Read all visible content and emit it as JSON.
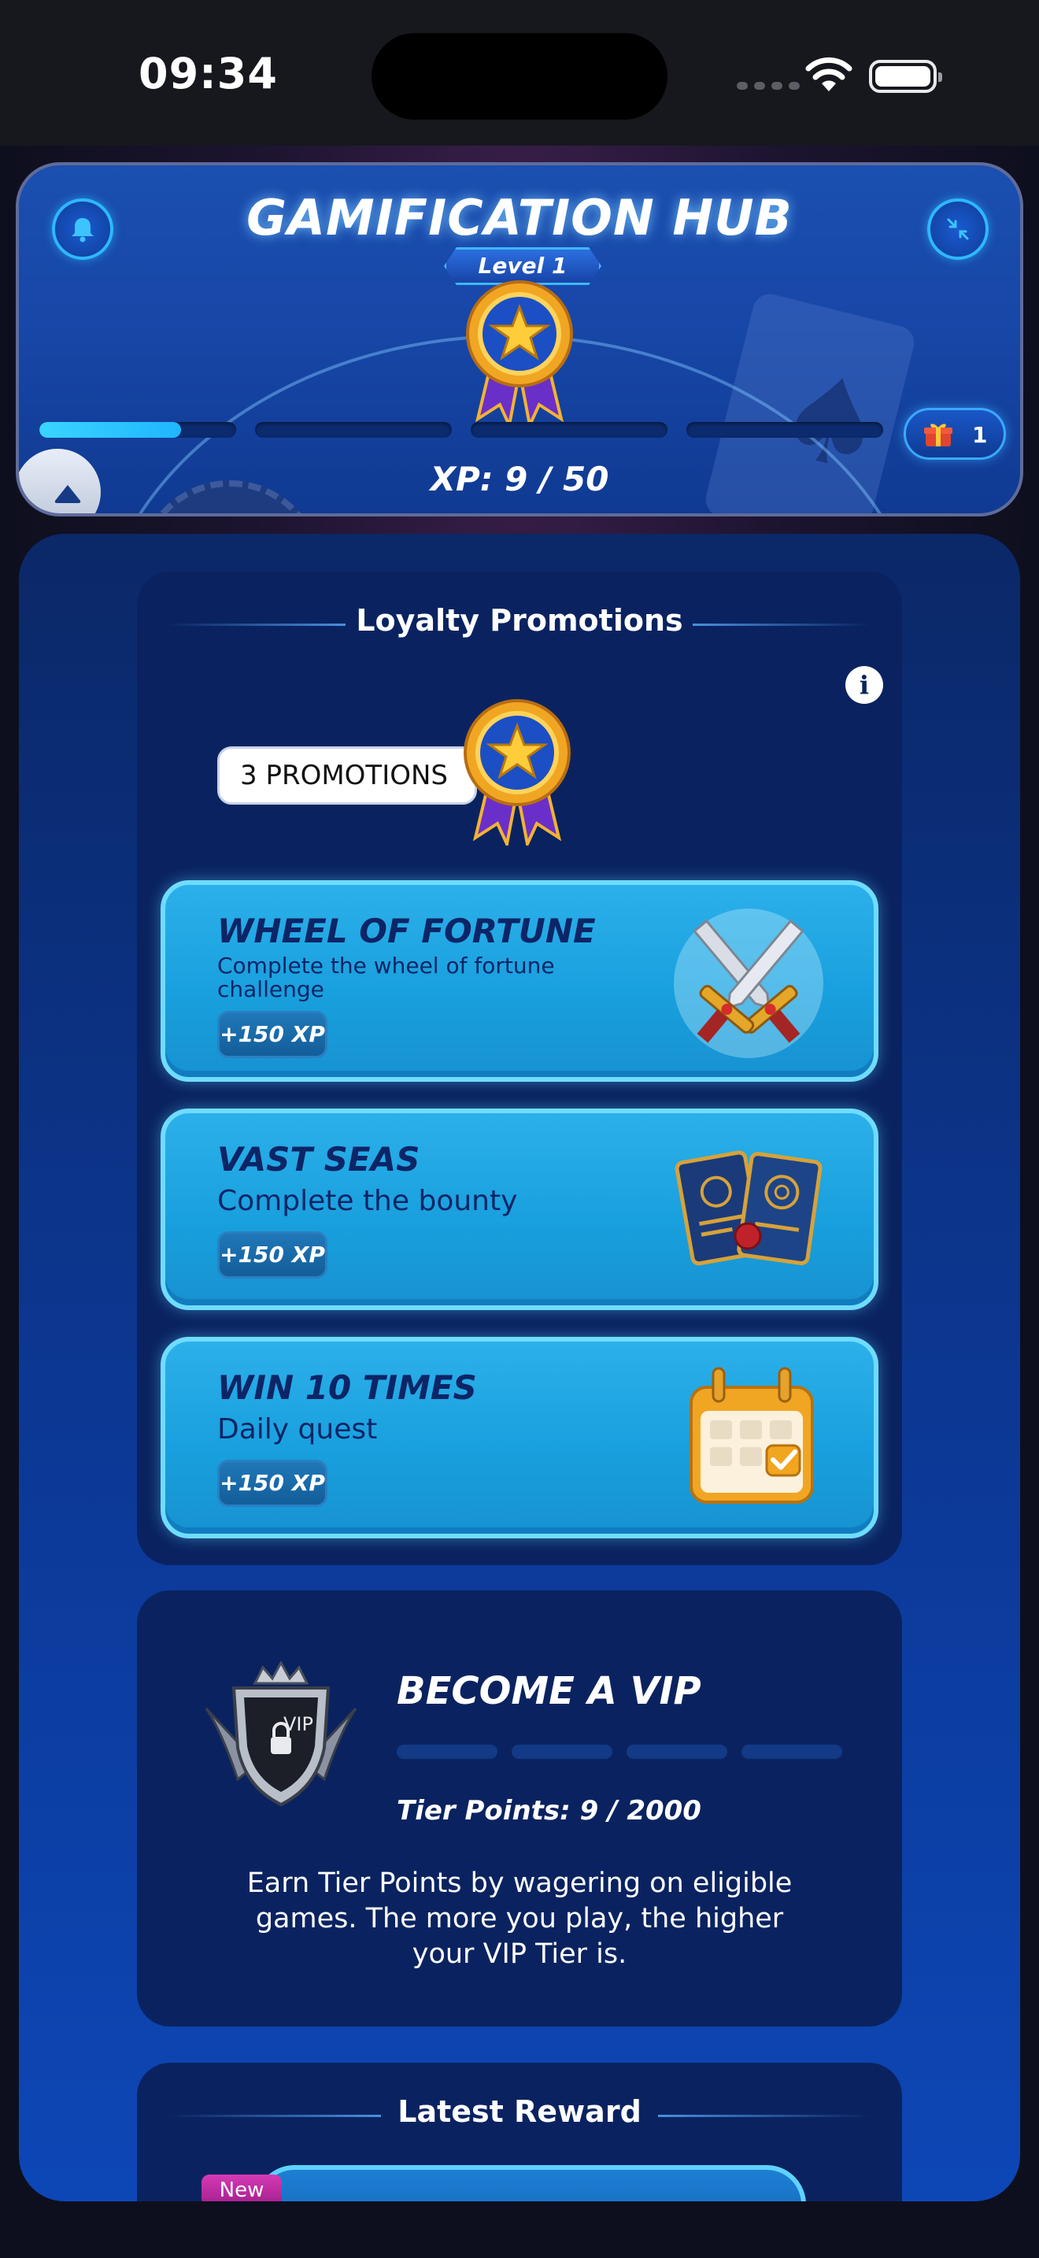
{
  "status_bar": {
    "time": "09:34"
  },
  "header": {
    "title": "GAMIFICATION HUB",
    "level_label": "Level 1",
    "xp_text": "XP: 9 / 50",
    "xp_progress_fraction": 0.18,
    "xp_segments": 4,
    "gift_count": "1",
    "icons": [
      "bell-icon",
      "collapse-icon",
      "medal-icon",
      "gift-icon",
      "chevron-up-icon"
    ]
  },
  "loyalty": {
    "title": "Loyalty Promotions",
    "count_label": "3 PROMOTIONS",
    "promotions": [
      {
        "title": "WHEEL OF FORTUNE",
        "description": "Complete the wheel of fortune challenge",
        "xp": "+150 XP",
        "icon": "crossed-swords-icon"
      },
      {
        "title": "VAST SEAS",
        "description": "Complete the bounty",
        "xp": "+150 XP",
        "icon": "bounty-cards-icon"
      },
      {
        "title": "WIN 10 TIMES",
        "description": "Daily quest",
        "xp": "+150 XP",
        "icon": "calendar-icon"
      }
    ]
  },
  "vip": {
    "title": "BECOME A VIP",
    "badge_text": "VIP",
    "tier_points": "Tier Points: 9 / 2000",
    "description": "Earn Tier Points by wagering on eligible games. The more you play, the higher your VIP Tier is."
  },
  "latest_reward": {
    "title": "Latest Reward",
    "new_badge": "New"
  },
  "colors": {
    "accent": "#2db8ff",
    "panel": "#0a2360",
    "promo_card": "#19a0de",
    "title_dark": "#0c2566"
  }
}
